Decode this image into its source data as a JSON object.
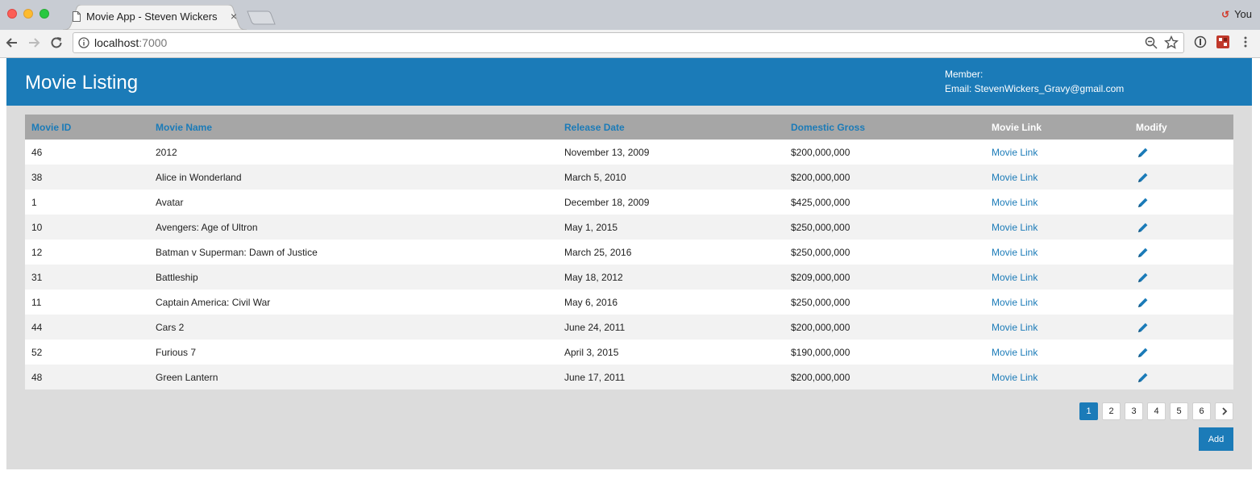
{
  "browser": {
    "tab_title": "Movie App - Steven Wickers",
    "tab_close": "×",
    "profile_name": "You",
    "url_host": "localhost",
    "url_port": ":7000"
  },
  "header": {
    "title": "Movie Listing",
    "member_label": "Member:",
    "email_label": "Email: StevenWickers_Gravy@gmail.com"
  },
  "table": {
    "columns": [
      "Movie ID",
      "Movie Name",
      "Release Date",
      "Domestic Gross",
      "Movie Link",
      "Modify"
    ],
    "rows": [
      {
        "id": "46",
        "name": "2012",
        "date": "November 13, 2009",
        "gross": "$200,000,000",
        "link": "Movie Link"
      },
      {
        "id": "38",
        "name": "Alice in Wonderland",
        "date": "March 5, 2010",
        "gross": "$200,000,000",
        "link": "Movie Link"
      },
      {
        "id": "1",
        "name": "Avatar",
        "date": "December 18, 2009",
        "gross": "$425,000,000",
        "link": "Movie Link"
      },
      {
        "id": "10",
        "name": "Avengers: Age of Ultron",
        "date": "May 1, 2015",
        "gross": "$250,000,000",
        "link": "Movie Link"
      },
      {
        "id": "12",
        "name": "Batman v Superman: Dawn of Justice",
        "date": "March 25, 2016",
        "gross": "$250,000,000",
        "link": "Movie Link"
      },
      {
        "id": "31",
        "name": "Battleship",
        "date": "May 18, 2012",
        "gross": "$209,000,000",
        "link": "Movie Link"
      },
      {
        "id": "11",
        "name": "Captain America: Civil War",
        "date": "May 6, 2016",
        "gross": "$250,000,000",
        "link": "Movie Link"
      },
      {
        "id": "44",
        "name": "Cars 2",
        "date": "June 24, 2011",
        "gross": "$200,000,000",
        "link": "Movie Link"
      },
      {
        "id": "52",
        "name": "Furious 7",
        "date": "April 3, 2015",
        "gross": "$190,000,000",
        "link": "Movie Link"
      },
      {
        "id": "48",
        "name": "Green Lantern",
        "date": "June 17, 2011",
        "gross": "$200,000,000",
        "link": "Movie Link"
      }
    ]
  },
  "pagination": {
    "pages": [
      "1",
      "2",
      "3",
      "4",
      "5",
      "6"
    ],
    "current": "1",
    "next": "›"
  },
  "actions": {
    "add_label": "Add"
  },
  "colors": {
    "brand": "#1b7bb8",
    "header_row": "#a6a6a6",
    "page_bg": "#dcdcdc"
  },
  "icons": {
    "tab": "document-icon",
    "edit": "pencil-icon",
    "next": "chevron-right-icon"
  }
}
